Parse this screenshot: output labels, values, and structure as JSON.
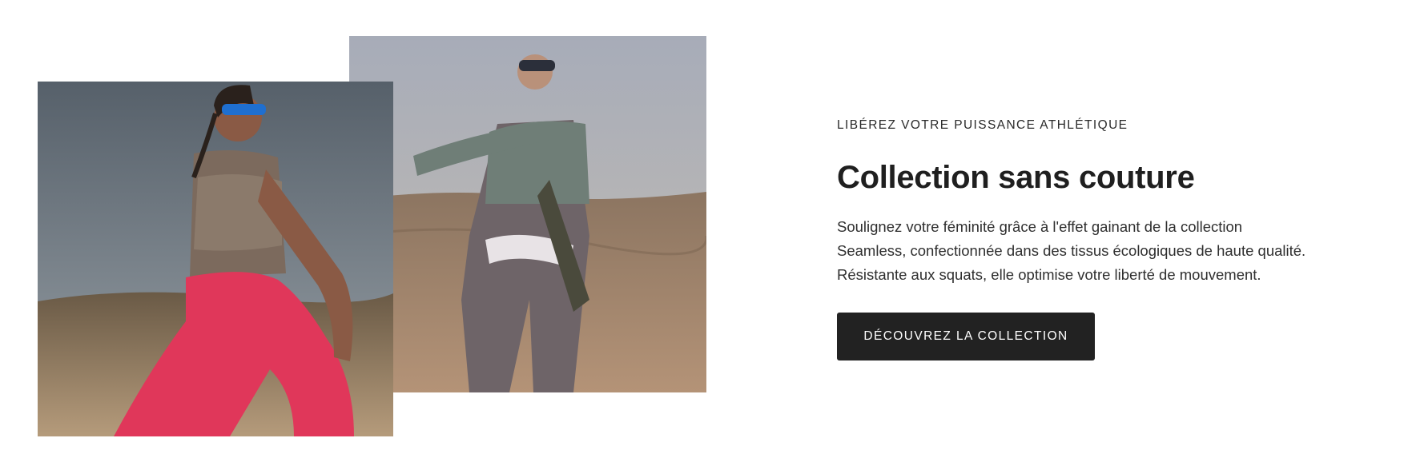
{
  "images": {
    "left": {
      "icon": "athlete-pink-leggings-photo"
    },
    "right": {
      "icon": "athlete-stretching-desert-photo"
    }
  },
  "hero": {
    "eyebrow": "LIBÉREZ VOTRE PUISSANCE ATHLÉTIQUE",
    "title": "Collection sans couture",
    "description_lines": [
      "Soulignez votre féminité grâce à l'effet gainant de la collection",
      "Seamless, confectionnée dans des tissus écologiques de haute qualité.",
      "Résistante aux squats, elle optimise votre liberté de mouvement."
    ],
    "cta_label": "DÉCOUVREZ LA COLLECTION"
  },
  "colors": {
    "cta_background": "#222222",
    "cta_text": "#ffffff",
    "leggings_pink": "#e0375a",
    "sky": "#8a98a6",
    "sand": "#b89878"
  }
}
